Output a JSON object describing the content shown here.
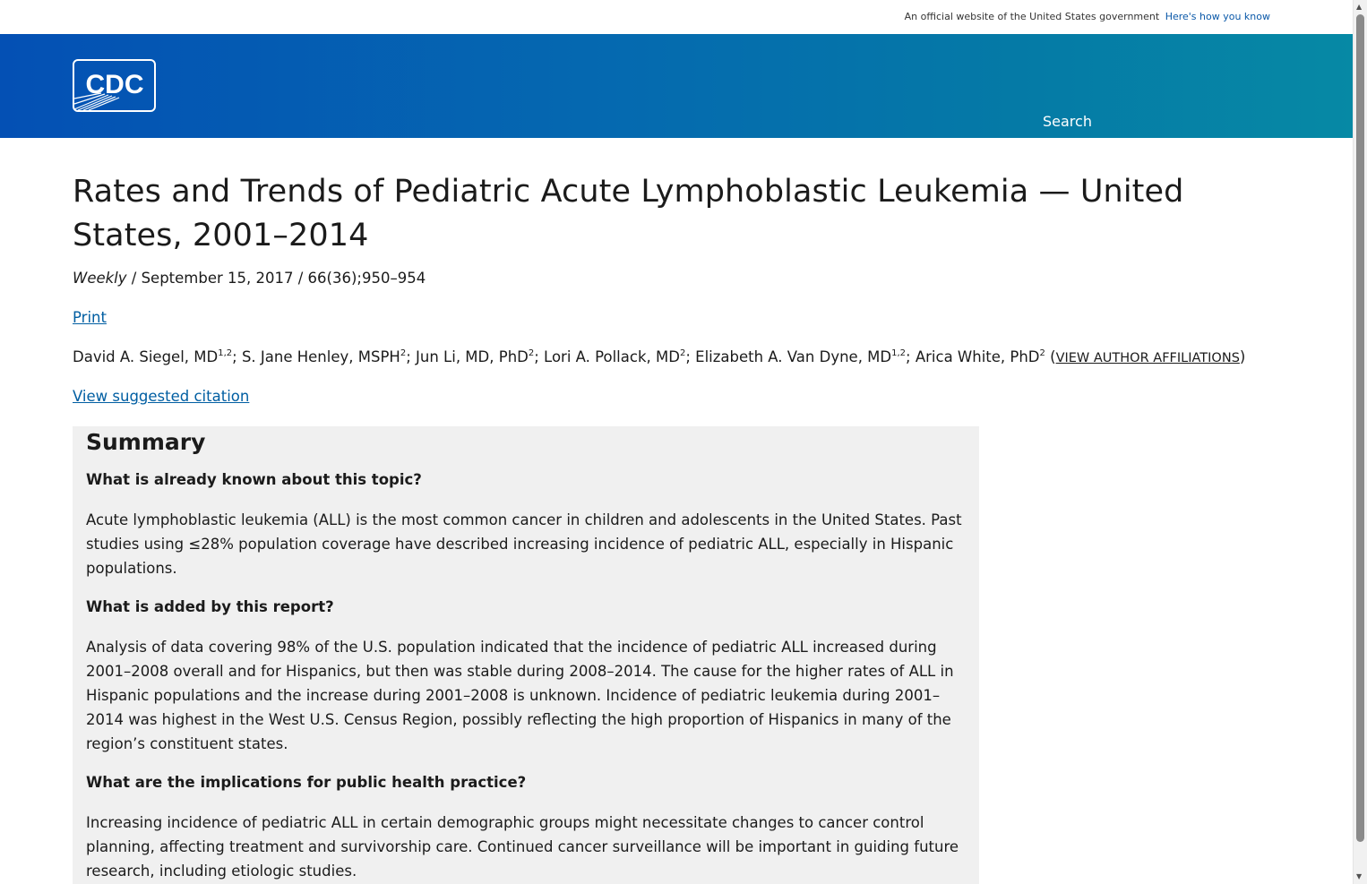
{
  "gov_banner": {
    "text": "An official website of the United States government",
    "link": "Here's how you know"
  },
  "header": {
    "logo_text": "CDC",
    "search": {
      "placeholder": "Search",
      "value": ""
    },
    "colors": {
      "gradient_start": "#0450b4",
      "gradient_end": "#0689a5"
    }
  },
  "article": {
    "title": "Rates and Trends of Pediatric Acute Lymphoblastic Leukemia — United States, 2001–2014",
    "meta": {
      "publication": "Weekly",
      "date_and_volume": " / September 15, 2017 / 66(36);950–954"
    },
    "print_label": "Print",
    "authors": [
      {
        "name": "David A. Siegel, MD",
        "sup": "1,2",
        "sep": "; "
      },
      {
        "name": "S. Jane Henley, MSPH",
        "sup": "2",
        "sep": "; "
      },
      {
        "name": "Jun Li, MD, PhD",
        "sup": "2",
        "sep": "; "
      },
      {
        "name": "Lori A. Pollack, MD",
        "sup": "2",
        "sep": "; "
      },
      {
        "name": "Elizabeth A. Van Dyne, MD",
        "sup": "1,2",
        "sep": "; "
      },
      {
        "name": "Arica White, PhD",
        "sup": "2",
        "sep": ""
      }
    ],
    "affiliations_link": "VIEW AUTHOR AFFILIATIONS",
    "citation_link": "View suggested citation"
  },
  "summary": {
    "heading": "Summary",
    "items": [
      {
        "question": "What is already known about this topic?",
        "answer": "Acute lymphoblastic leukemia (ALL) is the most common cancer in children and adolescents in the United States. Past studies using ≤28% population coverage have described increasing incidence of pediatric ALL, especially in Hispanic populations."
      },
      {
        "question": "What is added by this report?",
        "answer": "Analysis of data covering 98% of the U.S. population indicated that the incidence of pediatric ALL increased during 2001–2008 overall and for Hispanics, but then was stable during 2008–2014. The cause for the higher rates of ALL in Hispanic populations and the increase during 2001–2008 is unknown. Incidence of pediatric leukemia during 2001–2014 was highest in the West U.S. Census Region, possibly reflecting the high proportion of Hispanics in many of the region’s constituent states."
      },
      {
        "question": "What are the implications for public health practice?",
        "answer": "Increasing incidence of pediatric ALL in certain demographic groups might necessitate changes to cancer control planning, affecting treatment and survivorship care. Continued cancer surveillance will be important in guiding future research, including etiologic studies."
      }
    ]
  }
}
